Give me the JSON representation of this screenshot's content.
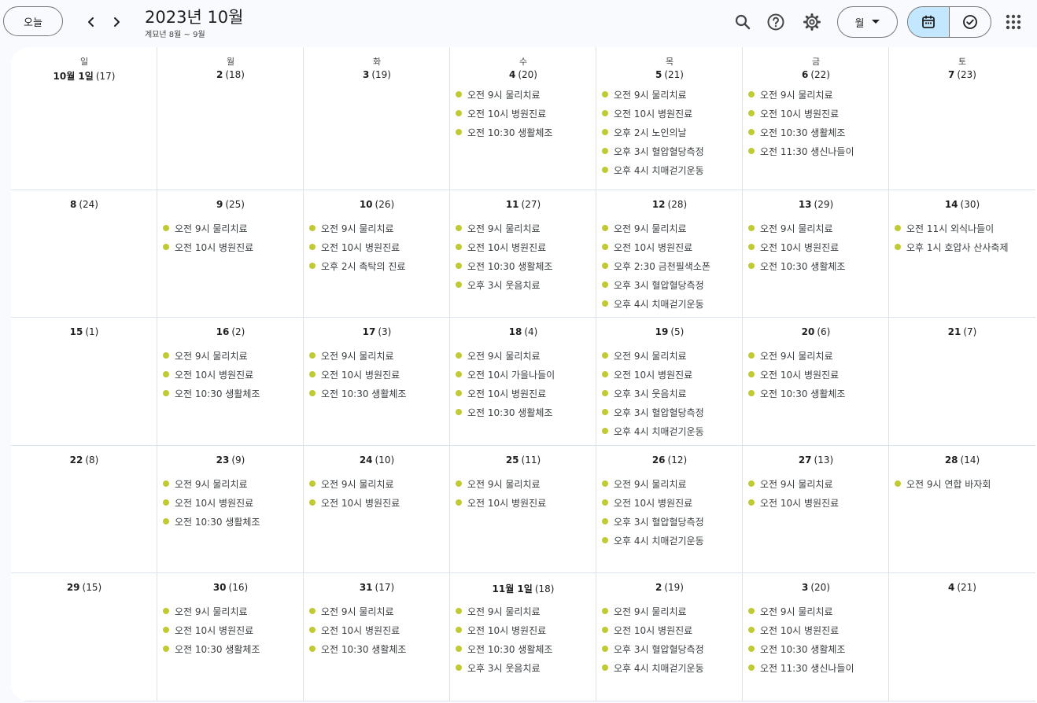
{
  "header": {
    "today_label": "오늘",
    "title": "2023년 10월",
    "subtitle": "계묘년 8월 ~ 9월",
    "view_label": "월"
  },
  "colors": {
    "event_dot": "#c0ca33",
    "active_toggle": "#c2e7ff"
  },
  "icons": [
    "chevron-left-icon",
    "chevron-right-icon",
    "search-icon",
    "help-icon",
    "gear-icon",
    "dropdown-arrow-icon",
    "calendar-icon",
    "task-check-icon",
    "apps-grid-icon"
  ],
  "weekdays": [
    "일",
    "월",
    "화",
    "수",
    "목",
    "금",
    "토"
  ],
  "weeks": [
    {
      "days": [
        {
          "num": "10월 1일",
          "lunar": "(17)",
          "events": []
        },
        {
          "num": "2",
          "lunar": "(18)",
          "events": []
        },
        {
          "num": "3",
          "lunar": "(19)",
          "events": []
        },
        {
          "num": "4",
          "lunar": "(20)",
          "events": [
            "오전 9시 물리치료",
            "오전 10시 병원진료",
            "오전 10:30 생활체조"
          ]
        },
        {
          "num": "5",
          "lunar": "(21)",
          "events": [
            "오전 9시 물리치료",
            "오전 10시 병원진료",
            "오후 2시 노인의날",
            "오후 3시 혈압혈당측정",
            "오후 4시 치매걷기운동"
          ]
        },
        {
          "num": "6",
          "lunar": "(22)",
          "events": [
            "오전 9시 물리치료",
            "오전 10시 병원진료",
            "오전 10:30 생활체조",
            "오전 11:30 생신나들이"
          ]
        },
        {
          "num": "7",
          "lunar": "(23)",
          "events": []
        }
      ]
    },
    {
      "days": [
        {
          "num": "8",
          "lunar": "(24)",
          "events": []
        },
        {
          "num": "9",
          "lunar": "(25)",
          "events": [
            "오전 9시 물리치료",
            "오전 10시 병원진료"
          ]
        },
        {
          "num": "10",
          "lunar": "(26)",
          "events": [
            "오전 9시 물리치료",
            "오전 10시 병원진료",
            "오후 2시 촉탁의 진료"
          ]
        },
        {
          "num": "11",
          "lunar": "(27)",
          "events": [
            "오전 9시 물리치료",
            "오전 10시 병원진료",
            "오전 10:30 생활체조",
            "오후 3시 웃음치료"
          ]
        },
        {
          "num": "12",
          "lunar": "(28)",
          "events": [
            "오전 9시 물리치료",
            "오전 10시 병원진료",
            "오후 2:30 금천필색소폰",
            "오후 3시 혈압혈당측정",
            "오후 4시 치매걷기운동"
          ]
        },
        {
          "num": "13",
          "lunar": "(29)",
          "events": [
            "오전 9시 물리치료",
            "오전 10시 병원진료",
            "오전 10:30 생활체조"
          ]
        },
        {
          "num": "14",
          "lunar": "(30)",
          "events": [
            "오전 11시 외식나들이",
            "오후 1시 호압사 산사축제"
          ]
        }
      ]
    },
    {
      "days": [
        {
          "num": "15",
          "lunar": "(1)",
          "events": []
        },
        {
          "num": "16",
          "lunar": "(2)",
          "events": [
            "오전 9시 물리치료",
            "오전 10시 병원진료",
            "오전 10:30 생활체조"
          ]
        },
        {
          "num": "17",
          "lunar": "(3)",
          "events": [
            "오전 9시 물리치료",
            "오전 10시 병원진료",
            "오전 10:30 생활체조"
          ]
        },
        {
          "num": "18",
          "lunar": "(4)",
          "events": [
            "오전 9시 물리치료",
            "오전 10시 가을나들이",
            "오전 10시 병원진료",
            "오전 10:30 생활체조"
          ]
        },
        {
          "num": "19",
          "lunar": "(5)",
          "events": [
            "오전 9시 물리치료",
            "오전 10시 병원진료",
            "오후 3시 웃음치료",
            "오후 3시 혈압혈당측정",
            "오후 4시 치매걷기운동"
          ]
        },
        {
          "num": "20",
          "lunar": "(6)",
          "events": [
            "오전 9시 물리치료",
            "오전 10시 병원진료",
            "오전 10:30 생활체조"
          ]
        },
        {
          "num": "21",
          "lunar": "(7)",
          "events": []
        }
      ]
    },
    {
      "days": [
        {
          "num": "22",
          "lunar": "(8)",
          "events": []
        },
        {
          "num": "23",
          "lunar": "(9)",
          "events": [
            "오전 9시 물리치료",
            "오전 10시 병원진료",
            "오전 10:30 생활체조"
          ]
        },
        {
          "num": "24",
          "lunar": "(10)",
          "events": [
            "오전 9시 물리치료",
            "오전 10시 병원진료"
          ]
        },
        {
          "num": "25",
          "lunar": "(11)",
          "events": [
            "오전 9시 물리치료",
            "오전 10시 병원진료"
          ]
        },
        {
          "num": "26",
          "lunar": "(12)",
          "events": [
            "오전 9시 물리치료",
            "오전 10시 병원진료",
            "오후 3시 혈압혈당측정",
            "오후 4시 치매걷기운동"
          ]
        },
        {
          "num": "27",
          "lunar": "(13)",
          "events": [
            "오전 9시 물리치료",
            "오전 10시 병원진료"
          ]
        },
        {
          "num": "28",
          "lunar": "(14)",
          "events": [
            "오전 9시 연합 바자회"
          ]
        }
      ]
    },
    {
      "days": [
        {
          "num": "29",
          "lunar": "(15)",
          "events": []
        },
        {
          "num": "30",
          "lunar": "(16)",
          "events": [
            "오전 9시 물리치료",
            "오전 10시 병원진료",
            "오전 10:30 생활체조"
          ]
        },
        {
          "num": "31",
          "lunar": "(17)",
          "events": [
            "오전 9시 물리치료",
            "오전 10시 병원진료",
            "오전 10:30 생활체조"
          ]
        },
        {
          "num": "11월 1일",
          "lunar": "(18)",
          "events": [
            "오전 9시 물리치료",
            "오전 10시 병원진료",
            "오전 10:30 생활체조",
            "오후 3시 웃음치료"
          ]
        },
        {
          "num": "2",
          "lunar": "(19)",
          "events": [
            "오전 9시 물리치료",
            "오전 10시 병원진료",
            "오후 3시 혈압혈당측정",
            "오후 4시 치매걷기운동"
          ]
        },
        {
          "num": "3",
          "lunar": "(20)",
          "events": [
            "오전 9시 물리치료",
            "오전 10시 병원진료",
            "오전 10:30 생활체조",
            "오전 11:30 생신나들이"
          ]
        },
        {
          "num": "4",
          "lunar": "(21)",
          "events": []
        }
      ]
    }
  ]
}
